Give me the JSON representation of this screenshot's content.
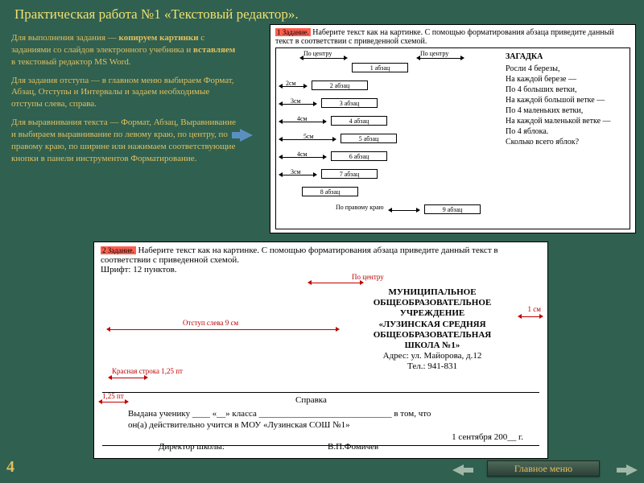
{
  "title": "Практическая работа №1 «Текстовый редактор».",
  "instructions": {
    "p1a": "Для выполнения задания — ",
    "p1b": "копируем картинки",
    "p1c": " с заданиями со слайдов электронного учебника и ",
    "p1d": "вставляем",
    "p1e": " в текстовый редактор MS Word.",
    "p2": "Для задания отступа — в главном меню выбираем  Формат, Абзац, Отступы и Интервалы и задаем необходимые отступы слева, справа.",
    "p3": "Для выравнивания текста — Формат, Абзац, Выравнивание и выбираем выравнивание по левому краю, по центру, по правому краю, по ширине или нажимаем соответствующие кнопки в панели инструментов Форматирование."
  },
  "task1": {
    "badge": "1 Задание.",
    "text": "Наберите текст как на картинке. С помощью форматирования абзаца приведите данный текст в соответствии с приведенной схемой.",
    "top_left_label": "По центру",
    "top_right_label": "По центру",
    "rows": [
      {
        "indent_label": "",
        "box": "1 абзац"
      },
      {
        "indent_label": "2см",
        "box": "2 абзац"
      },
      {
        "indent_label": "3см",
        "box": "3 абзац"
      },
      {
        "indent_label": "4см",
        "box": "4 абзац"
      },
      {
        "indent_label": "5см",
        "box": "5 абзац"
      },
      {
        "indent_label": "4см",
        "box": "6 абзац"
      },
      {
        "indent_label": "3см",
        "box": "7 абзац"
      },
      {
        "indent_label": "",
        "box": "8 абзац"
      },
      {
        "indent_label": "По правому краю",
        "box": "9 абзац"
      }
    ],
    "riddle": {
      "title": "ЗАГАДКА",
      "lines": [
        "Росли 4 березы,",
        "На каждой березе —",
        "По 4 больших ветки,",
        "На каждой большой ветке —",
        "По 4 маленьких ветки,",
        "На каждой маленькой ветке —",
        "По 4 яблока.",
        "Сколько всего яблок?"
      ]
    }
  },
  "task2": {
    "badge": "2 Задание.",
    "text": "Наберите текст как на картинке. С помощью форматирования абзаца приведите данный текст в соответствии с приведенной схемой.",
    "font_note": "Шрифт: 12 пунктов.",
    "labels": {
      "center": "По центру",
      "left_indent": "Отступ слева 9 см",
      "right_margin": "1 см",
      "red_line": "Красная строка 1,25 пт",
      "small": "1,25 пт"
    },
    "school": [
      "МУНИЦИПАЛЬНОЕ",
      "ОБЩЕОБРАЗОВАТЕЛЬНОЕ",
      "УЧРЕЖДЕНИЕ",
      "«ЛУЗИНСКАЯ СРЕДНЯЯ",
      "ОБЩЕОБРАЗОВАТЕЛЬНАЯ",
      "ШКОЛА №1»",
      "Адрес: ул. Майорова, д.12",
      "Тел.: 941-831"
    ],
    "spravka": "Справка",
    "body1": "Выдана ученику ____ «__» класса ______________________________ в том, что",
    "body2": "он(а) действительно учится в МОУ «Лузинская СОШ №1»",
    "date": "1 сентября 200__ г.",
    "director_label": "Директор школы:",
    "director_name": "В.П.Фомичев"
  },
  "footer": {
    "page": "4",
    "menu": "Главное меню"
  }
}
